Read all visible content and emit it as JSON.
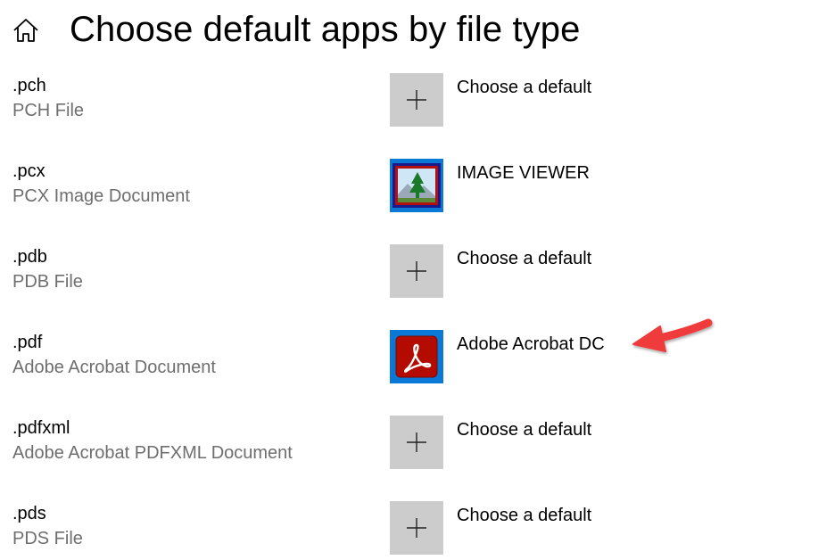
{
  "header": {
    "title": "Choose default apps by file type",
    "home_icon": "home-icon"
  },
  "rows": [
    {
      "extension": ".pch",
      "file_type": "PCH File",
      "app": "Choose a default",
      "icon": "plus-icon"
    },
    {
      "extension": ".pcx",
      "file_type": "PCX Image Document",
      "app": "IMAGE VIEWER",
      "icon": "image-viewer-icon"
    },
    {
      "extension": ".pdb",
      "file_type": "PDB File",
      "app": "Choose a default",
      "icon": "plus-icon"
    },
    {
      "extension": ".pdf",
      "file_type": "Adobe Acrobat Document",
      "app": "Adobe Acrobat DC",
      "icon": "acrobat-icon"
    },
    {
      "extension": ".pdfxml",
      "file_type": "Adobe Acrobat PDFXML Document",
      "app": "Choose a default",
      "icon": "plus-icon"
    },
    {
      "extension": ".pds",
      "file_type": "PDS File",
      "app": "Choose a default",
      "icon": "plus-icon"
    }
  ],
  "colors": {
    "accent": "#0a78d7",
    "tile_gray": "#cccccc",
    "secondary_text": "#6e6e6e",
    "annotation_arrow": "#ef3b3b"
  },
  "annotation": {
    "type": "arrow",
    "points_to": "Adobe Acrobat DC"
  }
}
